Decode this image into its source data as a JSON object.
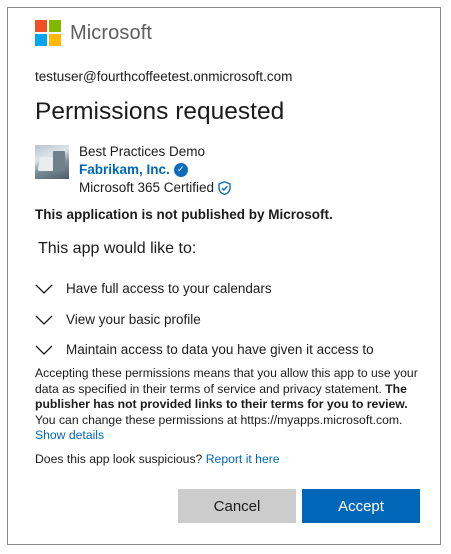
{
  "brand": {
    "name": "Microsoft",
    "logo_colors": [
      "#f25022",
      "#7fba00",
      "#00a4ef",
      "#ffb900"
    ]
  },
  "account": "testuser@fourthcoffeetest.onmicrosoft.com",
  "title": "Permissions requested",
  "app": {
    "name": "Best Practices Demo",
    "publisher": "Fabrikam, Inc.",
    "publisher_icon": "verified-badge-icon",
    "certification": "Microsoft 365 Certified",
    "certification_icon": "shield-check-icon"
  },
  "warning": "This application is not published by Microsoft.",
  "permissions_heading": "This app would like to:",
  "permissions": [
    "Have full access to your calendars",
    "View your basic profile",
    "Maintain access to data you have given it access to"
  ],
  "consent": {
    "text_1": "Accepting these permissions means that you allow this app to use your data as specified in their terms of service and privacy statement.",
    "bold": "The publisher has not provided links to their terms for you to review.",
    "text_2": "You can change these permissions at https://myapps.microsoft.com.",
    "link": "Show details"
  },
  "suspicious": {
    "text": "Does this app look suspicious?",
    "link": "Report it here"
  },
  "buttons": {
    "cancel": "Cancel",
    "accept": "Accept"
  },
  "colors": {
    "link": "#0067b8",
    "accept_bg": "#0067b8",
    "cancel_bg": "#cccccc"
  }
}
